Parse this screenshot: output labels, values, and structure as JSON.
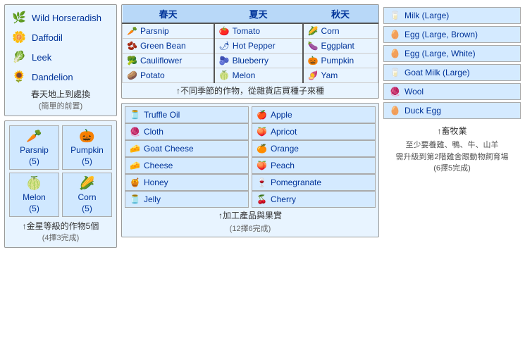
{
  "plants": {
    "title": "春天地上到處換",
    "subtitle": "(簡單的前置)",
    "items": [
      {
        "name": "Wild Horseradish",
        "icon": "horseradish"
      },
      {
        "name": "Daffodil",
        "icon": "daffodil"
      },
      {
        "name": "Leek",
        "icon": "leek"
      },
      {
        "name": "Dandelion",
        "icon": "dandelion"
      }
    ]
  },
  "star_crops": {
    "caption": "↑金星等級的作物5個",
    "subcaption": "(4擇3完成)",
    "items": [
      {
        "name": "Parsnip",
        "count": "(5)",
        "icon": "parsnip"
      },
      {
        "name": "Pumpkin",
        "count": "(5)",
        "icon": "pumpkin"
      },
      {
        "name": "Melon",
        "count": "(5)",
        "icon": "melon"
      },
      {
        "name": "Corn",
        "count": "(5)",
        "icon": "corn"
      }
    ]
  },
  "seasons": {
    "caption": "↑不同季節的作物，從雜貨店買種子來種",
    "headers": [
      "春天",
      "夏天",
      "秋天"
    ],
    "rows": [
      [
        {
          "name": "Parsnip",
          "icon": "parsnip"
        },
        {
          "name": "Tomato",
          "icon": "tomato"
        },
        {
          "name": "Corn",
          "icon": "corn"
        }
      ],
      [
        {
          "name": "Green Bean",
          "icon": "greenbean"
        },
        {
          "name": "Hot Pepper",
          "icon": "hotpepper"
        },
        {
          "name": "Eggplant",
          "icon": "eggplant"
        }
      ],
      [
        {
          "name": "Cauliflower",
          "icon": "cauliflower"
        },
        {
          "name": "Blueberry",
          "icon": "blueberry"
        },
        {
          "name": "Pumpkin",
          "icon": "pumpkin"
        }
      ],
      [
        {
          "name": "Potato",
          "icon": "potato"
        },
        {
          "name": "Melon",
          "icon": "melon"
        },
        {
          "name": "Yam",
          "icon": "yam"
        }
      ]
    ]
  },
  "artisan": {
    "caption": "↑加工產品與果實",
    "subcaption": "(12擇6完成)",
    "left_items": [
      {
        "name": "Truffle Oil",
        "icon": "truffle"
      },
      {
        "name": "Cloth",
        "icon": "cloth"
      },
      {
        "name": "Goat Cheese",
        "icon": "goatcheese"
      },
      {
        "name": "Cheese",
        "icon": "cheese"
      },
      {
        "name": "Honey",
        "icon": "honey"
      },
      {
        "name": "Jelly",
        "icon": "jelly"
      }
    ],
    "right_items": [
      {
        "name": "Apple",
        "icon": "apple"
      },
      {
        "name": "Apricot",
        "icon": "apricot"
      },
      {
        "name": "Orange",
        "icon": "orange"
      },
      {
        "name": "Peach",
        "icon": "peach"
      },
      {
        "name": "Pomegranate",
        "icon": "pomegranate"
      },
      {
        "name": "Cherry",
        "icon": "cherry"
      }
    ]
  },
  "livestock": {
    "caption": "↑畜牧業",
    "subcaption1": "至少要養雞、鴨、牛、山羊",
    "subcaption2": "需升級到第2階雞舍跟動物飼育場",
    "subcaption3": "(6擇5完成)",
    "items": [
      {
        "name": "Milk (Large)",
        "icon": "milk"
      },
      {
        "name": "Egg (Large, Brown)",
        "icon": "egg"
      },
      {
        "name": "Egg (Large, White)",
        "icon": "egg"
      },
      {
        "name": "Goat Milk (Large)",
        "icon": "goatmilk"
      },
      {
        "name": "Wool",
        "icon": "wool"
      },
      {
        "name": "Duck Egg",
        "icon": "duckegg"
      }
    ]
  }
}
